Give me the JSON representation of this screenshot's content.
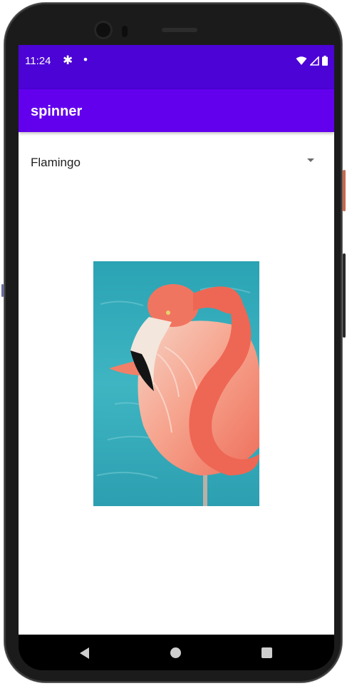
{
  "status_bar": {
    "time": "11:24",
    "icons": [
      "gear-icon",
      "notification-dot-icon",
      "wifi-icon",
      "signal-icon",
      "battery-icon"
    ]
  },
  "app_bar": {
    "title": "spinner"
  },
  "spinner": {
    "selected_value": "Flamingo"
  },
  "image": {
    "subject": "flamingo"
  },
  "nav_bar": {
    "icons": [
      "back-icon",
      "home-icon",
      "recent-apps-icon"
    ]
  },
  "colors": {
    "status_bar": "#4b03d6",
    "app_bar": "#6200ee",
    "background": "#ffffff",
    "water": "#33a8b5",
    "flamingo": "#f07060"
  }
}
